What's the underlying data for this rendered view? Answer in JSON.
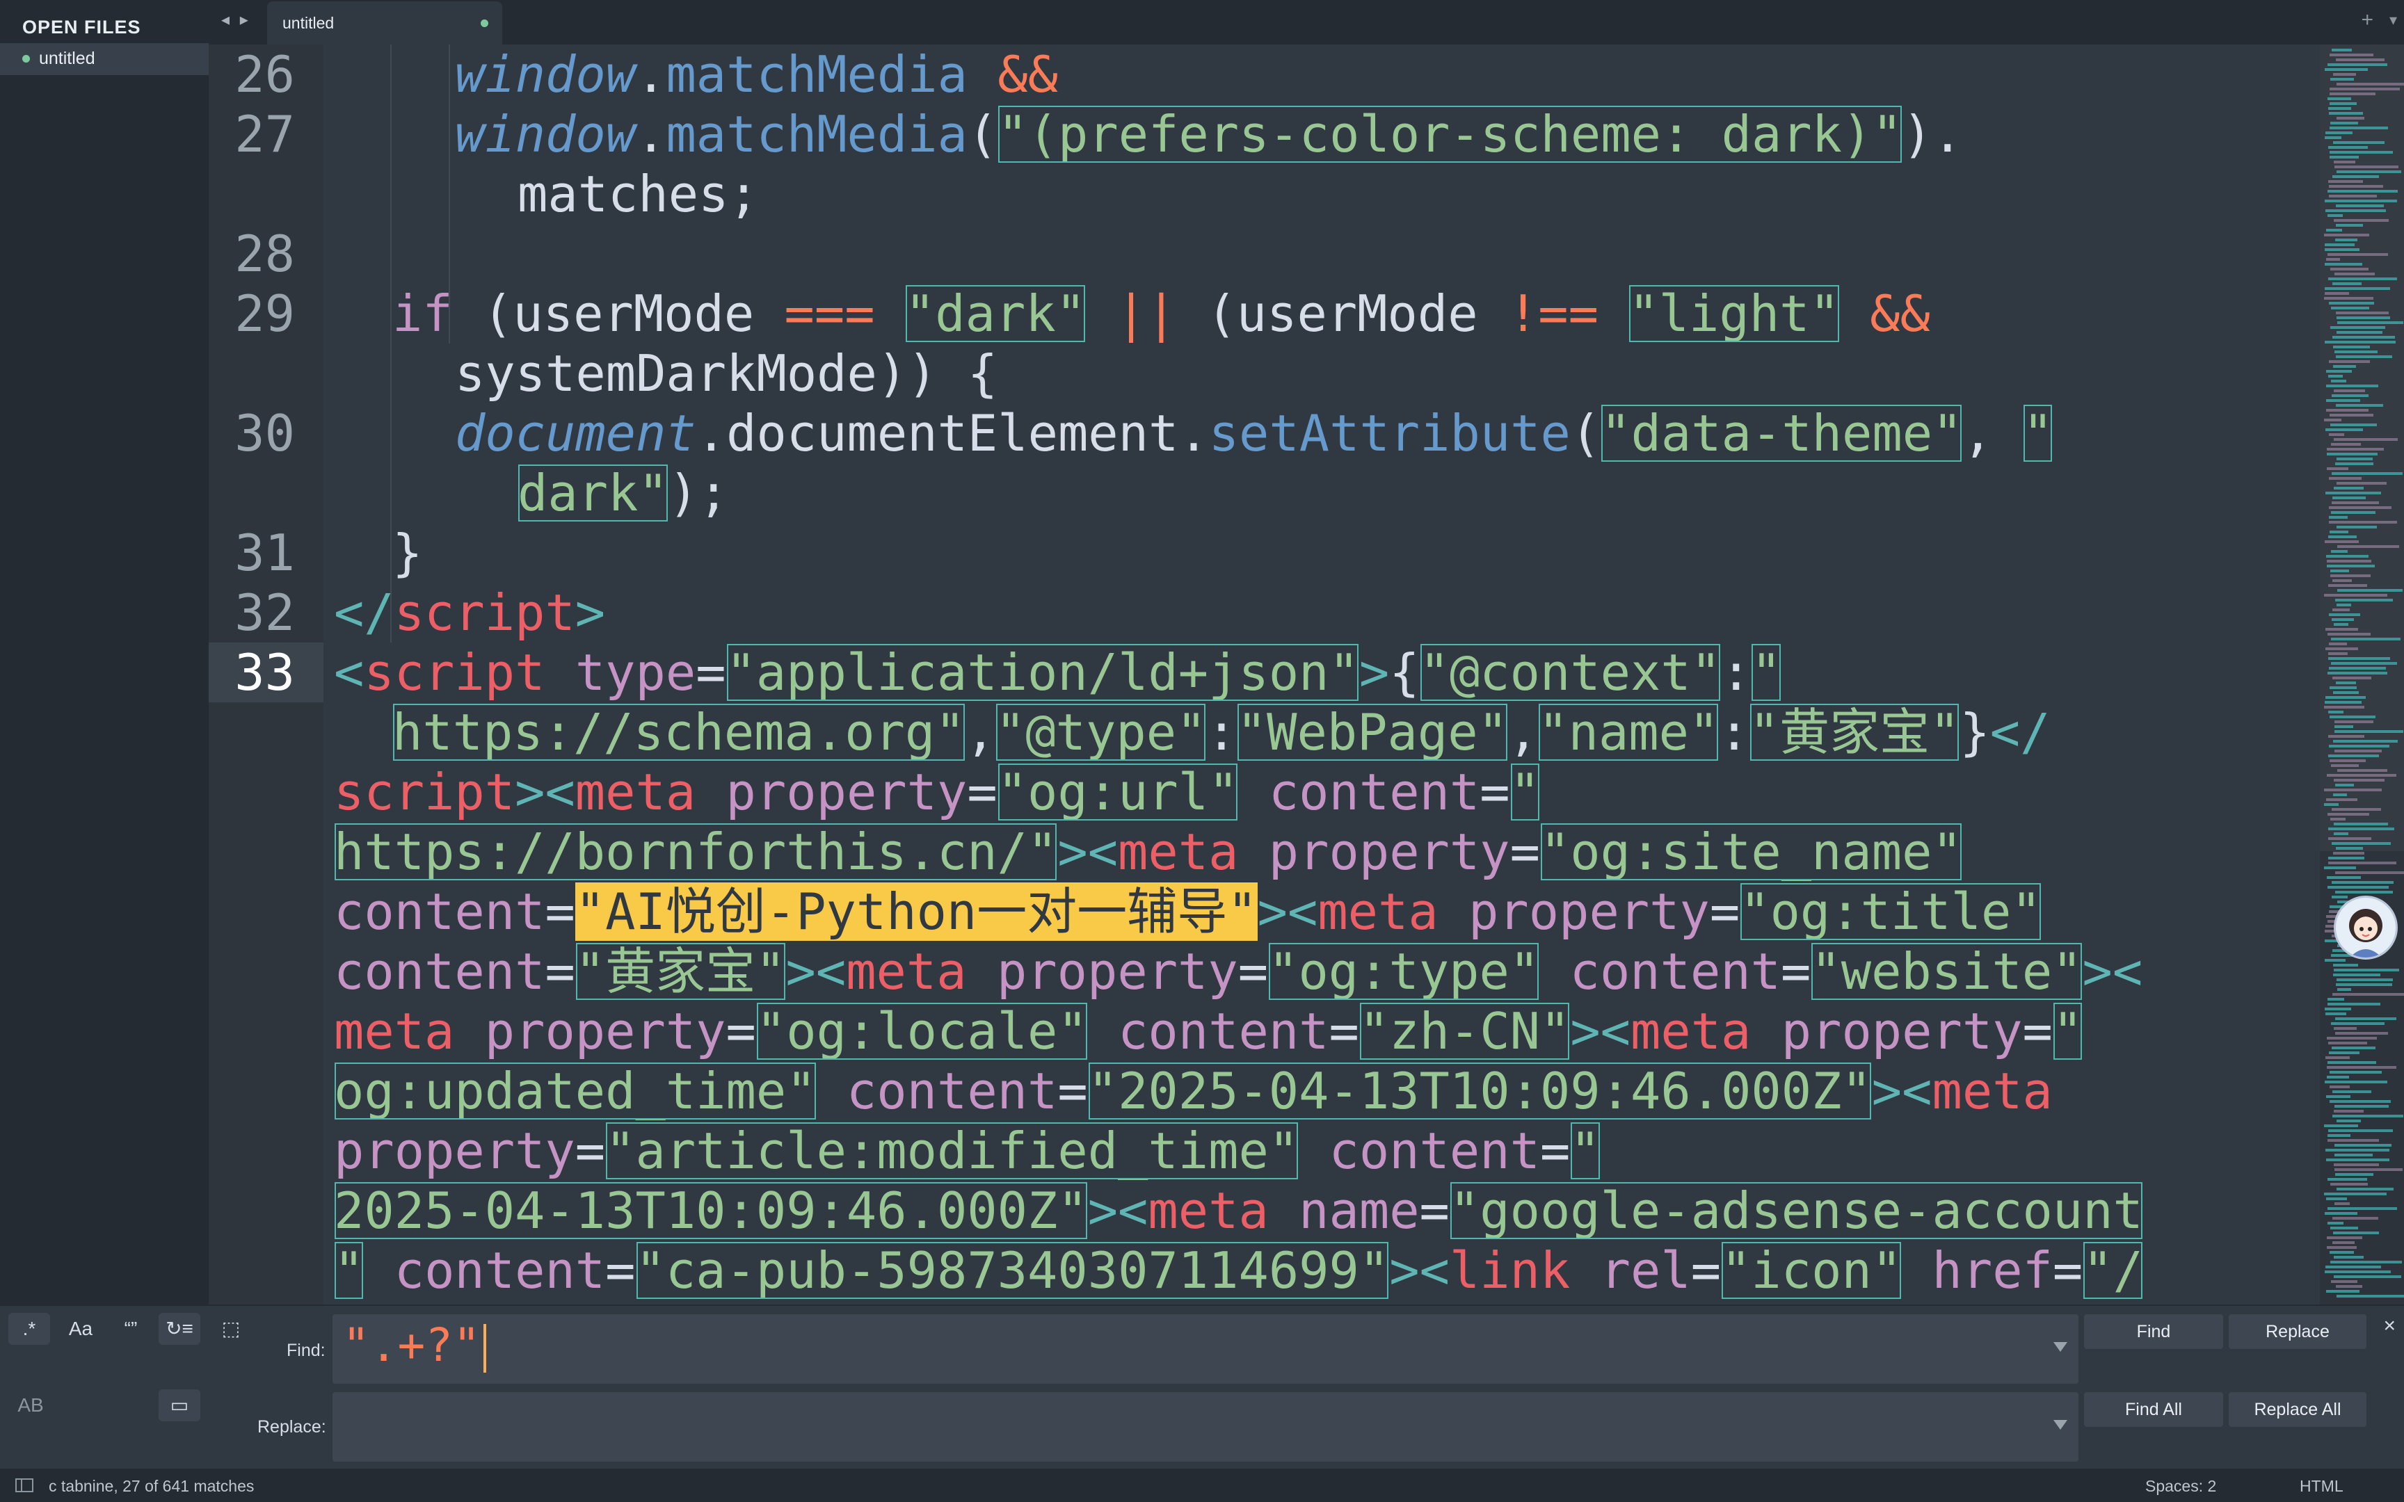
{
  "sidebar": {
    "title": "OPEN FILES",
    "files": [
      {
        "name": "untitled"
      }
    ]
  },
  "tabs": [
    {
      "label": "untitled"
    }
  ],
  "tabbar": {
    "nav": "◂ ▸",
    "new_tab": "+",
    "menu": "▾"
  },
  "line_numbers": [
    "26",
    "27",
    "28",
    "29",
    "30",
    "31",
    "32",
    "33"
  ],
  "find_panel": {
    "find_label": "Find:",
    "replace_label": "Replace:",
    "find_value": "\".+?\"",
    "replace_value": "",
    "buttons": {
      "find": "Find",
      "replace": "Replace",
      "find_all": "Find All",
      "replace_all": "Replace All"
    },
    "options": {
      "regex": ".*",
      "case": "Aa",
      "whole_word": "“”",
      "wrap": "↻≡",
      "in_selection": "⬚",
      "preserve_case": "AB",
      "highlight": "▭"
    },
    "close": "×"
  },
  "status": {
    "message": "c tabnine, 27 of 641 matches",
    "spaces": "Spaces: 2",
    "syntax": "HTML"
  },
  "colors": {
    "background": "#303841",
    "sidebar": "#252b32",
    "string": "#99c794",
    "match_outline": "#4fb9b0",
    "current_match": "#f9c948",
    "keyword": "#c594c5",
    "operator": "#f97b58",
    "function": "#6699cc",
    "tag": "#ec5f66"
  },
  "code": [
    [
      [
        "it",
        "window"
      ],
      [
        "pl",
        "."
      ],
      [
        "fn",
        "matchMedia"
      ],
      [
        "pl",
        " "
      ],
      [
        "op",
        "&&"
      ]
    ],
    [
      [
        "it",
        "window"
      ],
      [
        "pl",
        "."
      ],
      [
        "fn",
        "matchMedia"
      ],
      [
        "pl",
        "("
      ],
      [
        "s",
        "\"(prefers-color-scheme: dark)\""
      ],
      [
        "pl",
        ")."
      ]
    ],
    [
      [
        "pl",
        "matches;"
      ]
    ],
    [],
    [
      [
        "kw",
        "if"
      ],
      [
        "pl",
        " (userMode "
      ],
      [
        "op",
        "==="
      ],
      [
        "pl",
        " "
      ],
      [
        "s",
        "\"dark\""
      ],
      [
        "pl",
        " "
      ],
      [
        "op",
        "||"
      ],
      [
        "pl",
        " (userMode "
      ],
      [
        "op",
        "!=="
      ],
      [
        "pl",
        " "
      ],
      [
        "s",
        "\"light\""
      ],
      [
        "pl",
        " "
      ],
      [
        "op",
        "&&"
      ]
    ],
    [
      [
        "pl",
        "systemDarkMode)) {"
      ]
    ],
    [
      [
        "it",
        "document"
      ],
      [
        "pl",
        ".documentElement."
      ],
      [
        "fn",
        "setAttribute"
      ],
      [
        "pl",
        "("
      ],
      [
        "s",
        "\"data-theme\""
      ],
      [
        "pl",
        ", "
      ],
      [
        "s",
        "\""
      ]
    ],
    [
      [
        "s",
        "dark\""
      ],
      [
        "pl",
        ");"
      ]
    ],
    [
      [
        "pl",
        "}"
      ]
    ],
    [
      [
        "br",
        "</"
      ],
      [
        "tg",
        "script"
      ],
      [
        "br",
        ">"
      ]
    ],
    [
      [
        "br",
        "<"
      ],
      [
        "tg",
        "script"
      ],
      [
        "pl",
        " "
      ],
      [
        "at",
        "type"
      ],
      [
        "pl",
        "="
      ],
      [
        "s",
        "\"application/ld+json\""
      ],
      [
        "br",
        ">"
      ],
      [
        "pl",
        "{"
      ],
      [
        "s",
        "\"@context\""
      ],
      [
        "pl",
        ":"
      ],
      [
        "s",
        "\""
      ]
    ],
    [
      [
        "s",
        "https://schema.org\""
      ],
      [
        "pl",
        ","
      ],
      [
        "s",
        "\"@type\""
      ],
      [
        "pl",
        ":"
      ],
      [
        "s",
        "\"WebPage\""
      ],
      [
        "pl",
        ","
      ],
      [
        "s",
        "\"name\""
      ],
      [
        "pl",
        ":"
      ],
      [
        "s",
        "\"黄家宝\""
      ],
      [
        "pl",
        "}"
      ],
      [
        "br",
        "</"
      ]
    ],
    [
      [
        "tg",
        "script"
      ],
      [
        "br",
        "><"
      ],
      [
        "tg",
        "meta"
      ],
      [
        "pl",
        " "
      ],
      [
        "at",
        "property"
      ],
      [
        "pl",
        "="
      ],
      [
        "s",
        "\"og:url\""
      ],
      [
        "pl",
        " "
      ],
      [
        "at",
        "content"
      ],
      [
        "pl",
        "="
      ],
      [
        "s",
        "\""
      ]
    ],
    [
      [
        "s",
        "https://bornforthis.cn/\""
      ],
      [
        "br",
        "><"
      ],
      [
        "tg",
        "meta"
      ],
      [
        "pl",
        " "
      ],
      [
        "at",
        "property"
      ],
      [
        "pl",
        "="
      ],
      [
        "s",
        "\"og:site_name\""
      ]
    ],
    [
      [
        "at",
        "content"
      ],
      [
        "pl",
        "="
      ],
      [
        "cur",
        "\"AI悦创-Python一对一辅导\""
      ],
      [
        "br",
        "><"
      ],
      [
        "tg",
        "meta"
      ],
      [
        "pl",
        " "
      ],
      [
        "at",
        "property"
      ],
      [
        "pl",
        "="
      ],
      [
        "s",
        "\"og:title\""
      ]
    ],
    [
      [
        "at",
        "content"
      ],
      [
        "pl",
        "="
      ],
      [
        "s",
        "\"黄家宝\""
      ],
      [
        "br",
        "><"
      ],
      [
        "tg",
        "meta"
      ],
      [
        "pl",
        " "
      ],
      [
        "at",
        "property"
      ],
      [
        "pl",
        "="
      ],
      [
        "s",
        "\"og:type\""
      ],
      [
        "pl",
        " "
      ],
      [
        "at",
        "content"
      ],
      [
        "pl",
        "="
      ],
      [
        "s",
        "\"website\""
      ],
      [
        "br",
        "><"
      ]
    ],
    [
      [
        "tg",
        "meta"
      ],
      [
        "pl",
        " "
      ],
      [
        "at",
        "property"
      ],
      [
        "pl",
        "="
      ],
      [
        "s",
        "\"og:locale\""
      ],
      [
        "pl",
        " "
      ],
      [
        "at",
        "content"
      ],
      [
        "pl",
        "="
      ],
      [
        "s",
        "\"zh-CN\""
      ],
      [
        "br",
        "><"
      ],
      [
        "tg",
        "meta"
      ],
      [
        "pl",
        " "
      ],
      [
        "at",
        "property"
      ],
      [
        "pl",
        "="
      ],
      [
        "s",
        "\""
      ]
    ],
    [
      [
        "s",
        "og:updated_time\""
      ],
      [
        "pl",
        " "
      ],
      [
        "at",
        "content"
      ],
      [
        "pl",
        "="
      ],
      [
        "s",
        "\"2025-04-13T10:09:46.000Z\""
      ],
      [
        "br",
        "><"
      ],
      [
        "tg",
        "meta"
      ]
    ],
    [
      [
        "at",
        "property"
      ],
      [
        "pl",
        "="
      ],
      [
        "s",
        "\"article:modified_time\""
      ],
      [
        "pl",
        " "
      ],
      [
        "at",
        "content"
      ],
      [
        "pl",
        "="
      ],
      [
        "s",
        "\""
      ]
    ],
    [
      [
        "s",
        "2025-04-13T10:09:46.000Z\""
      ],
      [
        "br",
        "><"
      ],
      [
        "tg",
        "meta"
      ],
      [
        "pl",
        " "
      ],
      [
        "at",
        "name"
      ],
      [
        "pl",
        "="
      ],
      [
        "s",
        "\"google-adsense-account"
      ]
    ],
    [
      [
        "s",
        "\""
      ],
      [
        "pl",
        " "
      ],
      [
        "at",
        "content"
      ],
      [
        "pl",
        "="
      ],
      [
        "s",
        "\"ca-pub-5987340307114699\""
      ],
      [
        "br",
        "><"
      ],
      [
        "tg",
        "link"
      ],
      [
        "pl",
        " "
      ],
      [
        "at",
        "rel"
      ],
      [
        "pl",
        "="
      ],
      [
        "s",
        "\"icon\""
      ],
      [
        "pl",
        " "
      ],
      [
        "at",
        "href"
      ],
      [
        "pl",
        "="
      ],
      [
        "s",
        "\"/"
      ]
    ]
  ]
}
